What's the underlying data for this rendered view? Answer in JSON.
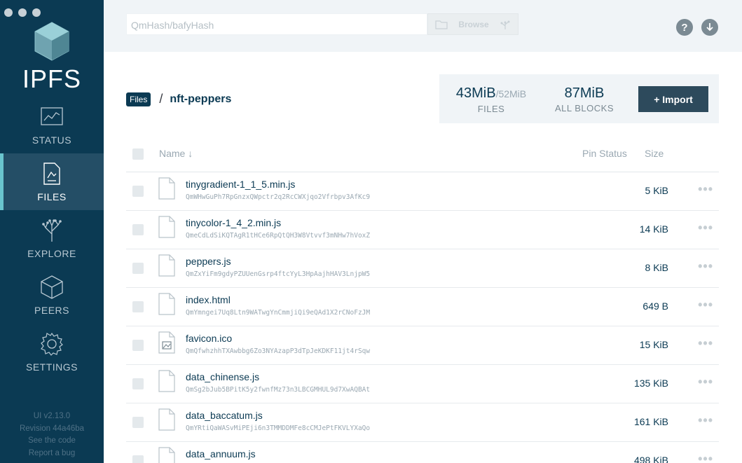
{
  "sidebar": {
    "logo_text": "IPFS",
    "items": [
      {
        "label": "STATUS",
        "icon": "status-chart-icon"
      },
      {
        "label": "FILES",
        "icon": "files-icon"
      },
      {
        "label": "EXPLORE",
        "icon": "explore-tree-icon"
      },
      {
        "label": "PEERS",
        "icon": "peers-cube-icon"
      },
      {
        "label": "SETTINGS",
        "icon": "settings-gear-icon"
      }
    ],
    "active": "FILES",
    "footer": {
      "version": "UI v2.13.0",
      "revision": "Revision 44a46ba",
      "see_code": "See the code",
      "report_bug": "Report a bug"
    }
  },
  "topbar": {
    "search_placeholder": "QmHash/bafyHash",
    "browse_label": "Browse",
    "help_icon": "?",
    "update_icon": "update-icon"
  },
  "breadcrumb": {
    "root": "Files",
    "separator": "/",
    "current": "nft-peppers"
  },
  "stats": {
    "files_size": "43MiB",
    "files_total": "/52MiB",
    "files_label": "FILES",
    "blocks_size": "87MiB",
    "blocks_label": "ALL BLOCKS",
    "import_label": "+ Import"
  },
  "table": {
    "col_name": "Name ↓",
    "col_pin": "Pin Status",
    "col_size": "Size",
    "rows": [
      {
        "name": "tinygradient-1_1_5.min.js",
        "hash": "QmWHwGuPh7RpGnzxQWpctr2q2RcCWXjqo2Vfrbpv3AfKc9",
        "size": "5 KiB",
        "type": "doc"
      },
      {
        "name": "tinycolor-1_4_2.min.js",
        "hash": "QmeCdLdSiKQTAgR1tHCe6RpQtQH3W8Vtvvf3mNHw7hVoxZ",
        "size": "14 KiB",
        "type": "doc"
      },
      {
        "name": "peppers.js",
        "hash": "QmZxYiFm9gdyPZUUenGsrp4ftcYyL3HpAajhHAV3LnjpW5",
        "size": "8 KiB",
        "type": "doc"
      },
      {
        "name": "index.html",
        "hash": "QmYmngei7Uq8Ltn9WATwgYnCmmjiQi9eQAd1X2rCNoFzJM",
        "size": "649 B",
        "type": "doc"
      },
      {
        "name": "favicon.ico",
        "hash": "QmQfwhzhhTXAwbbg6Zo3NYAzapP3dTpJeKDKF11jt4rSqw",
        "size": "15 KiB",
        "type": "image"
      },
      {
        "name": "data_chinense.js",
        "hash": "QmSg2bJub5BPitK5y2fwnfMz73n3LBCGMHUL9d7XwAQBAt",
        "size": "135 KiB",
        "type": "doc"
      },
      {
        "name": "data_baccatum.js",
        "hash": "QmYRtiQaWASvMiPEji6n3TMMDDMFe8cCMJePtFKVLYXaQo",
        "size": "161 KiB",
        "type": "doc"
      },
      {
        "name": "data_annuum.js",
        "hash": "",
        "size": "498 KiB",
        "type": "doc"
      }
    ],
    "more_icon": "•••"
  }
}
